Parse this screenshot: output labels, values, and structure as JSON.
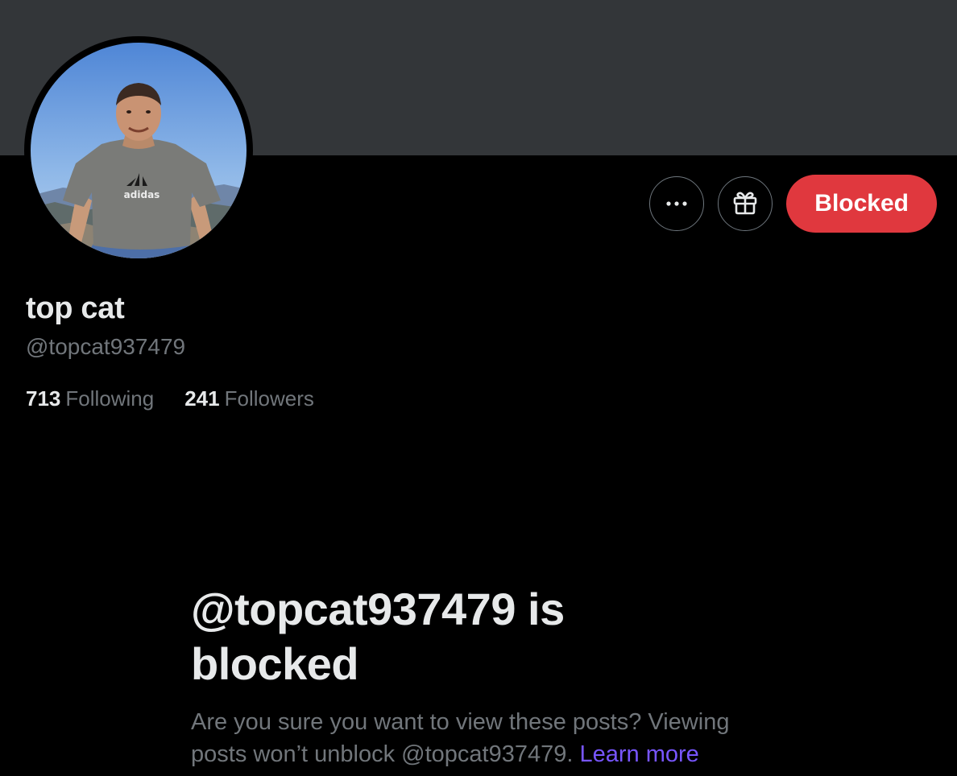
{
  "profile": {
    "display_name": "top cat",
    "handle": "@topcat937479",
    "following_count": "713",
    "following_label": "Following",
    "followers_count": "241",
    "followers_label": "Followers",
    "avatar_shirt_text": "adidas"
  },
  "actions": {
    "more_icon": "more-horizontal-icon",
    "gift_icon": "gift-icon",
    "blocked_label": "Blocked"
  },
  "blocked_notice": {
    "title_line1": "@topcat937479 is",
    "title_line2": "blocked",
    "message_line1": "Are you sure you want to view these posts? Viewing",
    "message_line2": "posts won’t unblock @topcat937479.",
    "learn_more": "Learn more"
  },
  "colors": {
    "banner": "#333639",
    "background": "#000000",
    "blocked_button": "#e0383e",
    "link": "#7856ff",
    "secondary_text": "#71767b",
    "primary_text": "#e7e9ea"
  }
}
